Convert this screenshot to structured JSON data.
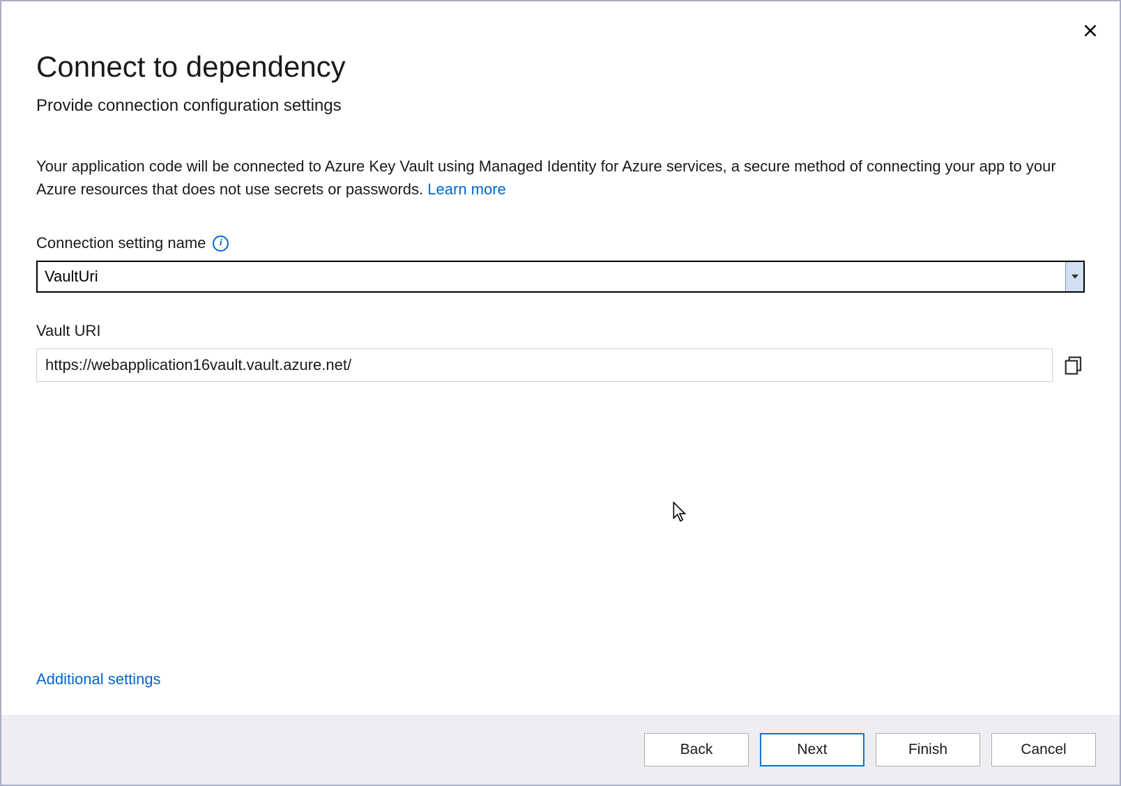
{
  "dialog": {
    "title": "Connect to dependency",
    "subtitle": "Provide connection configuration settings",
    "description_prefix": "Your application code will be connected to Azure Key Vault using Managed Identity for Azure services, a secure method of connecting your app to your Azure resources that does not use secrets or passwords.   ",
    "learn_more": "Learn more"
  },
  "fields": {
    "connection_label": "Connection setting name",
    "connection_value": "VaultUri",
    "vault_uri_label": "Vault URI",
    "vault_uri_value": "https://webapplication16vault.vault.azure.net/"
  },
  "links": {
    "additional_settings": "Additional settings"
  },
  "buttons": {
    "back": "Back",
    "next": "Next",
    "finish": "Finish",
    "cancel": "Cancel"
  }
}
